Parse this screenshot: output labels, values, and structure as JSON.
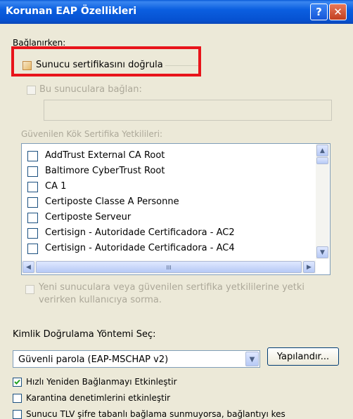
{
  "window": {
    "title": "Korunan EAP Özellikleri",
    "help_glyph": "?",
    "close_glyph": "✕"
  },
  "connect_group": {
    "label": "Bağlanırken:",
    "validate_cert_label": "Sunucu sertifikasını doğrula",
    "connect_servers_label": "Bu sunuculara bağlan:",
    "servers_value": ""
  },
  "trusted_ca": {
    "label": "Güvenilen Kök Sertifika Yetkilileri:",
    "items": [
      "AddTrust External CA Root",
      "Baltimore CyberTrust Root",
      "CA 1",
      "Certiposte Classe A Personne",
      "Certiposte Serveur",
      "Certisign - Autoridade Certificadora - AC2",
      "Certisign - Autoridade Certificadora - AC4"
    ],
    "hscroll_thumb": "III"
  },
  "no_prompt": {
    "line1": "Yeni sunuculara veya güvenilen sertifika yetkililerine yetki",
    "line2": "verirken kullanıcıya sorma."
  },
  "auth_method": {
    "label": "Kimlik Doğrulama Yöntemi Seç:",
    "selected": "Güvenli parola (EAP-MSCHAP v2)",
    "configure_label": "Yapılandır..."
  },
  "options": [
    {
      "label": "Hızlı Yeniden Bağlanmayı Etkinleştir",
      "checked": true
    },
    {
      "label": "Karantina denetimlerini etkinleştir",
      "checked": false
    },
    {
      "label": "Sunucu TLV şifre tabanlı bağlama sunmuyorsa, bağlantıyı kes",
      "checked": false
    }
  ],
  "colors": {
    "titlebar": "#0b5fe0",
    "highlight_box": "#e8141b",
    "dialog_bg": "#ece9d8"
  }
}
